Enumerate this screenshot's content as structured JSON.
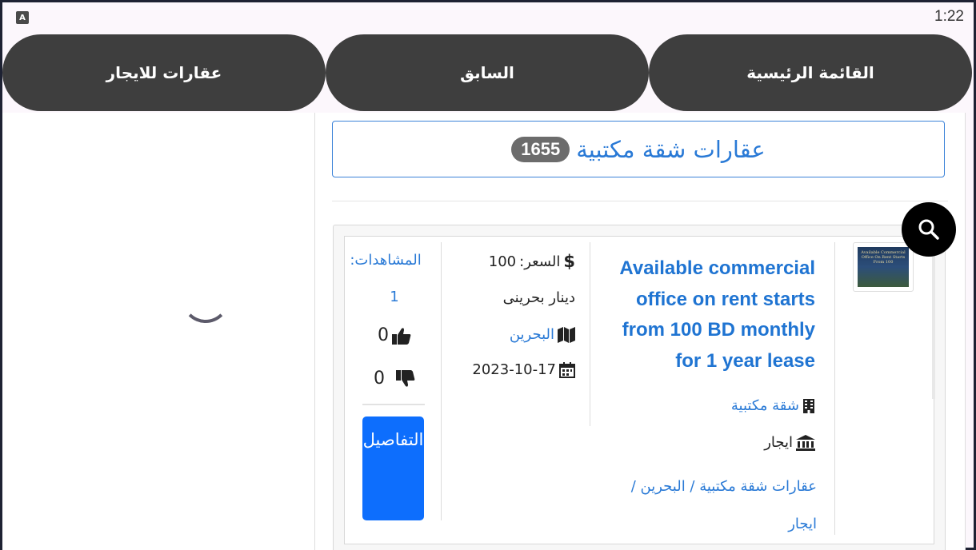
{
  "status_bar": {
    "app_badge": "A",
    "time": "1:22"
  },
  "nav": {
    "home": "القائمة الرئيسية",
    "back": "السابق",
    "rent": "عقارات للايجار"
  },
  "header": {
    "title": "عقارات شقة مكتبية",
    "count": "1655"
  },
  "listing": {
    "title": "Available commercial office on rent starts from 100 BD monthly for 1 year lease",
    "thumb_text": "Available Commercial Office On Rent Starts From 100",
    "category": "شقة مكتبية",
    "type": "ايجار",
    "breadcrumb": "عقارات شقة مكتبية / البحرين / ايجار",
    "price_label": "السعر:",
    "price_value": "100",
    "currency": "دينار بحرينى",
    "location": "البحرين",
    "date": "2023-10-17",
    "views_label": "المشاهدات:",
    "views_value": "1",
    "likes": "0",
    "dislikes": "0",
    "details_button": "التفاصيل"
  },
  "icons": {
    "accent": "#0d6efd",
    "link_color": "#2a7ad6",
    "nav_bg": "#3e3e3e"
  }
}
